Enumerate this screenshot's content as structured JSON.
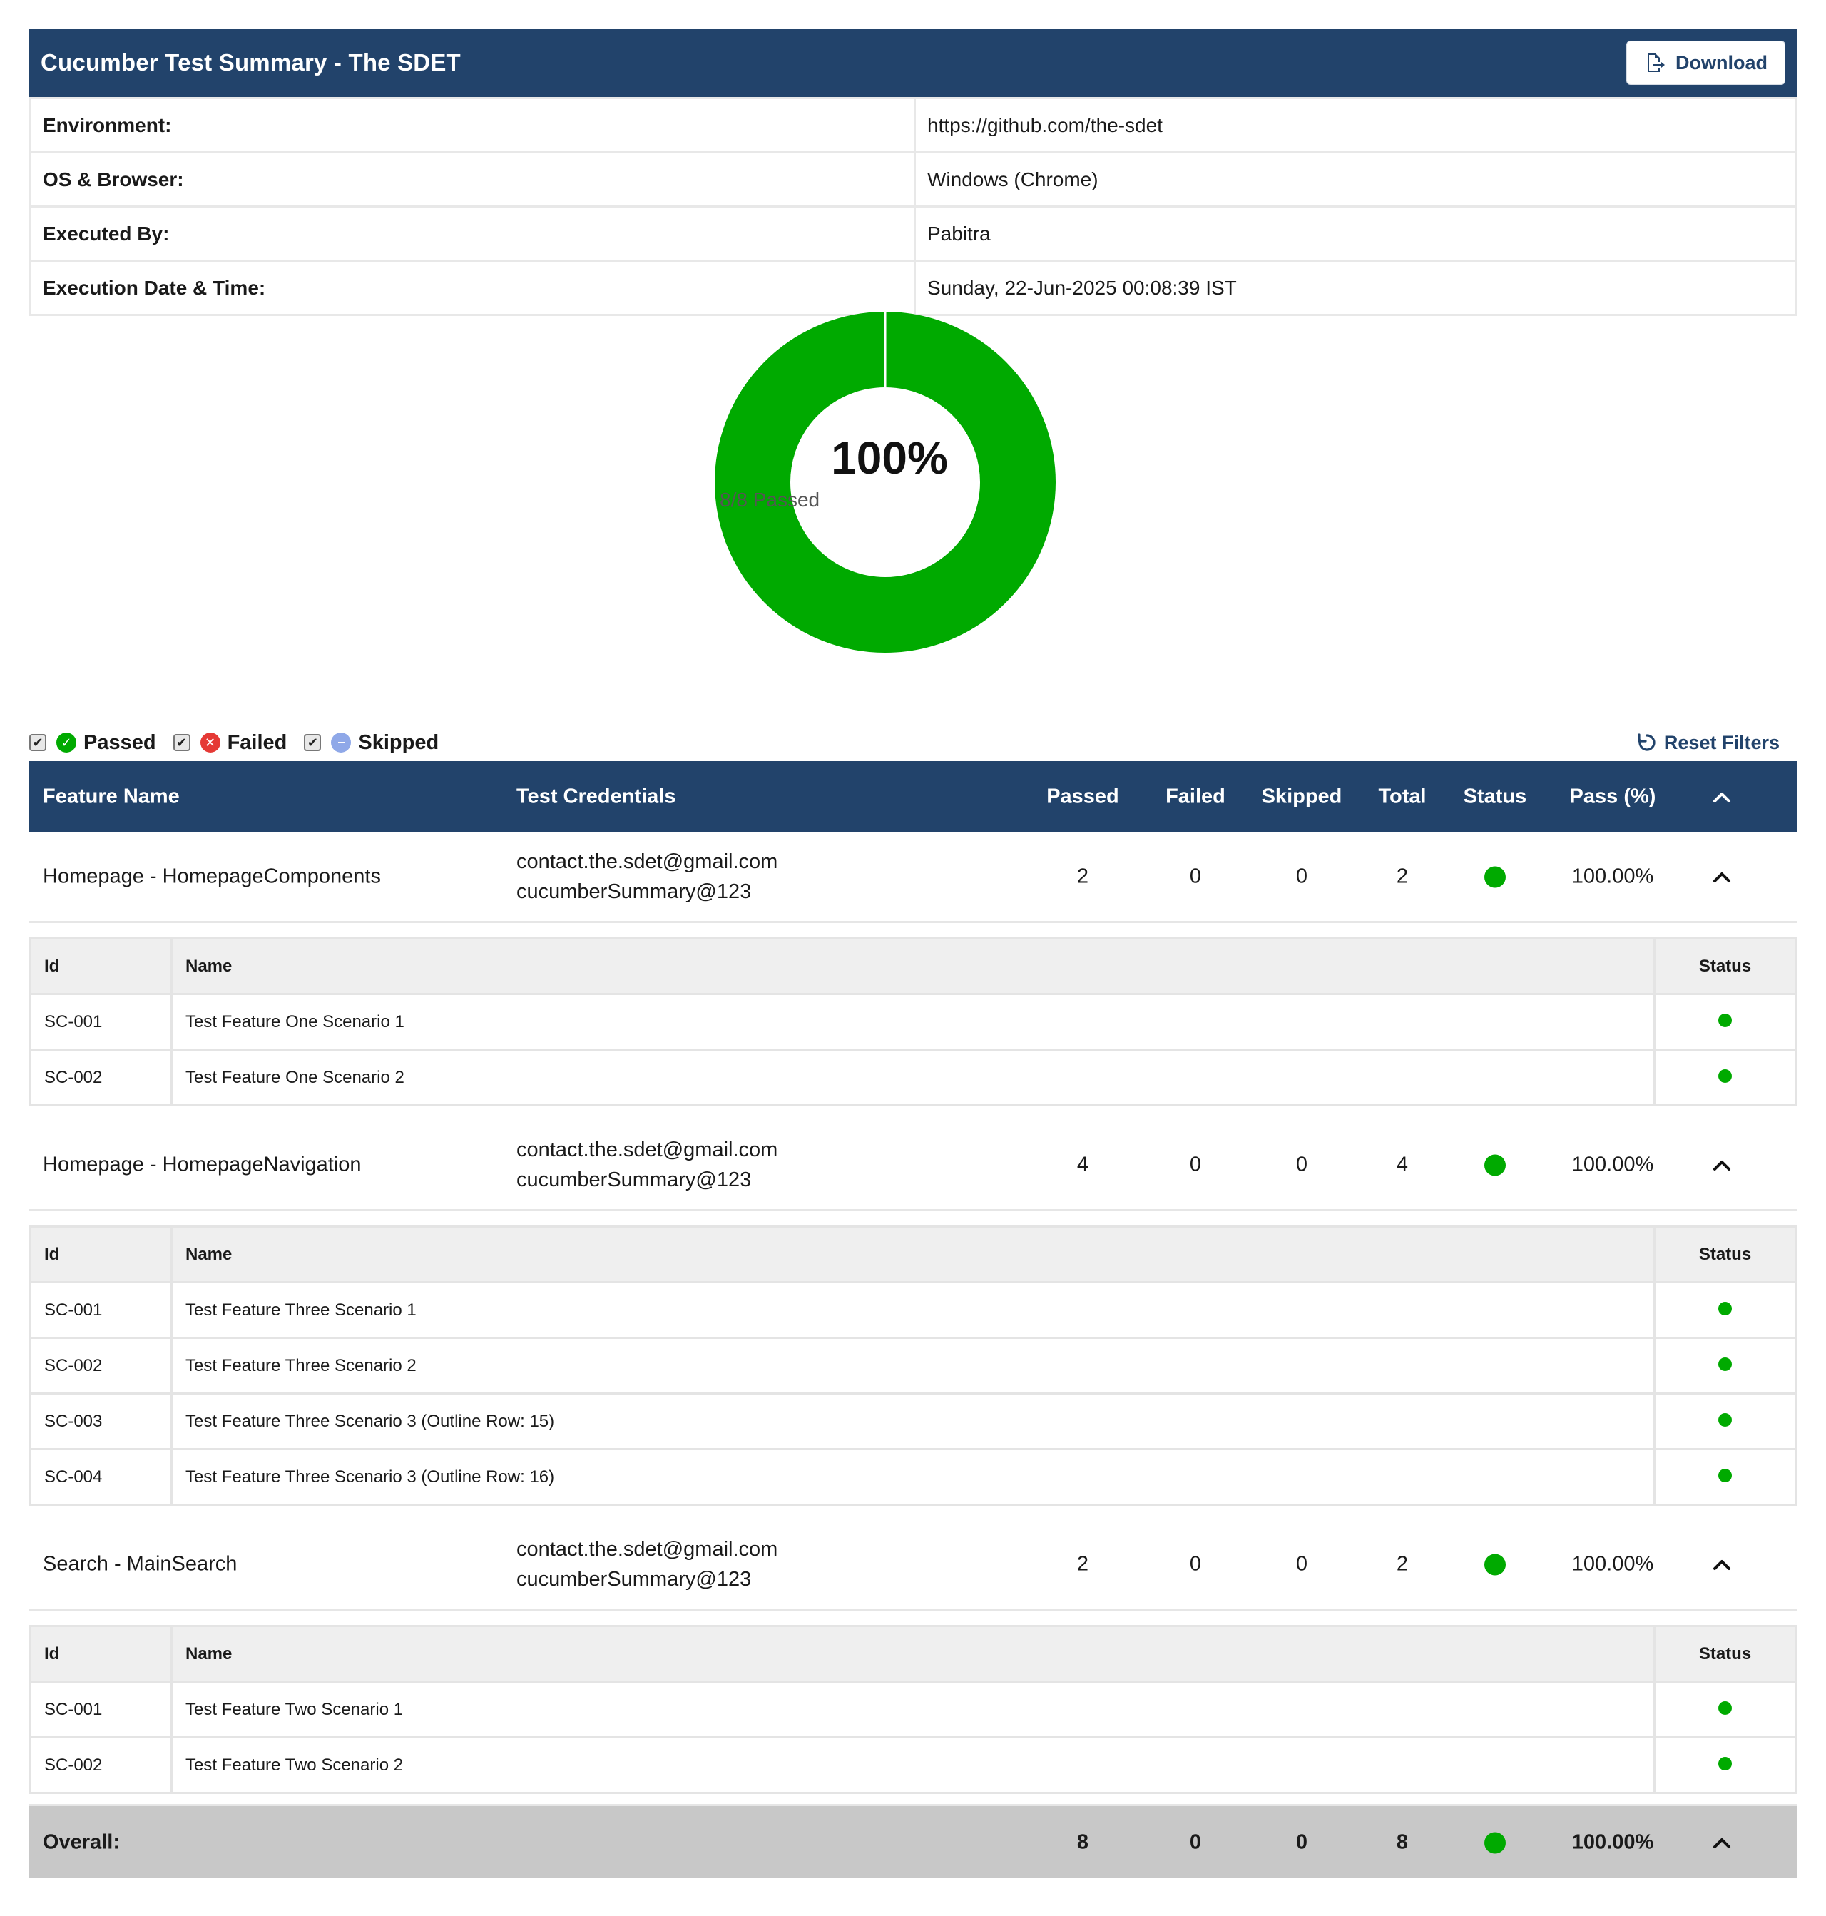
{
  "header": {
    "title": "Cucumber Test Summary - The SDET",
    "download_label": "Download"
  },
  "env": [
    {
      "key": "Environment:",
      "value": "https://github.com/the-sdet"
    },
    {
      "key": "OS & Browser:",
      "value": "Windows (Chrome)"
    },
    {
      "key": "Executed By:",
      "value": "Pabitra"
    },
    {
      "key": "Execution Date & Time:",
      "value": "Sunday, 22-Jun-2025 00:08:39 IST"
    }
  ],
  "donut": {
    "percent_label": "100%",
    "sub_label": "8/8 Passed",
    "passed": 8,
    "failed": 0,
    "skipped": 0,
    "pass_color": "#00aa00"
  },
  "filters": {
    "passed": "Passed",
    "failed": "Failed",
    "skipped": "Skipped",
    "reset": "Reset Filters",
    "colors": {
      "passed": "#00aa00",
      "failed": "#e53935",
      "skipped": "#8fa8e8"
    }
  },
  "table": {
    "headers": {
      "name": "Feature Name",
      "cred": "Test Credentials",
      "passed": "Passed",
      "failed": "Failed",
      "skipped": "Skipped",
      "total": "Total",
      "status": "Status",
      "pct": "Pass (%)"
    },
    "sub_headers": {
      "id": "Id",
      "name": "Name",
      "status": "Status"
    },
    "features": [
      {
        "name": "Homepage - HomepageComponents",
        "cred1": "contact.the.sdet@gmail.com",
        "cred2": "cucumberSummary@123",
        "passed": "2",
        "failed": "0",
        "skipped": "0",
        "total": "2",
        "pct": "100.00%",
        "scenarios": [
          {
            "id": "SC-001",
            "name": "Test Feature One Scenario 1"
          },
          {
            "id": "SC-002",
            "name": "Test Feature One Scenario 2"
          }
        ]
      },
      {
        "name": "Homepage - HomepageNavigation",
        "cred1": "contact.the.sdet@gmail.com",
        "cred2": "cucumberSummary@123",
        "passed": "4",
        "failed": "0",
        "skipped": "0",
        "total": "4",
        "pct": "100.00%",
        "scenarios": [
          {
            "id": "SC-001",
            "name": "Test Feature Three Scenario 1"
          },
          {
            "id": "SC-002",
            "name": "Test Feature Three Scenario 2"
          },
          {
            "id": "SC-003",
            "name": "Test Feature Three Scenario 3 (Outline Row: 15)"
          },
          {
            "id": "SC-004",
            "name": "Test Feature Three Scenario 3 (Outline Row: 16)"
          }
        ]
      },
      {
        "name": "Search - MainSearch",
        "cred1": "contact.the.sdet@gmail.com",
        "cred2": "cucumberSummary@123",
        "passed": "2",
        "failed": "0",
        "skipped": "0",
        "total": "2",
        "pct": "100.00%",
        "scenarios": [
          {
            "id": "SC-001",
            "name": "Test Feature Two Scenario 1"
          },
          {
            "id": "SC-002",
            "name": "Test Feature Two Scenario 2"
          }
        ]
      }
    ],
    "overall": {
      "label": "Overall:",
      "passed": "8",
      "failed": "0",
      "skipped": "0",
      "total": "8",
      "pct": "100.00%"
    }
  }
}
